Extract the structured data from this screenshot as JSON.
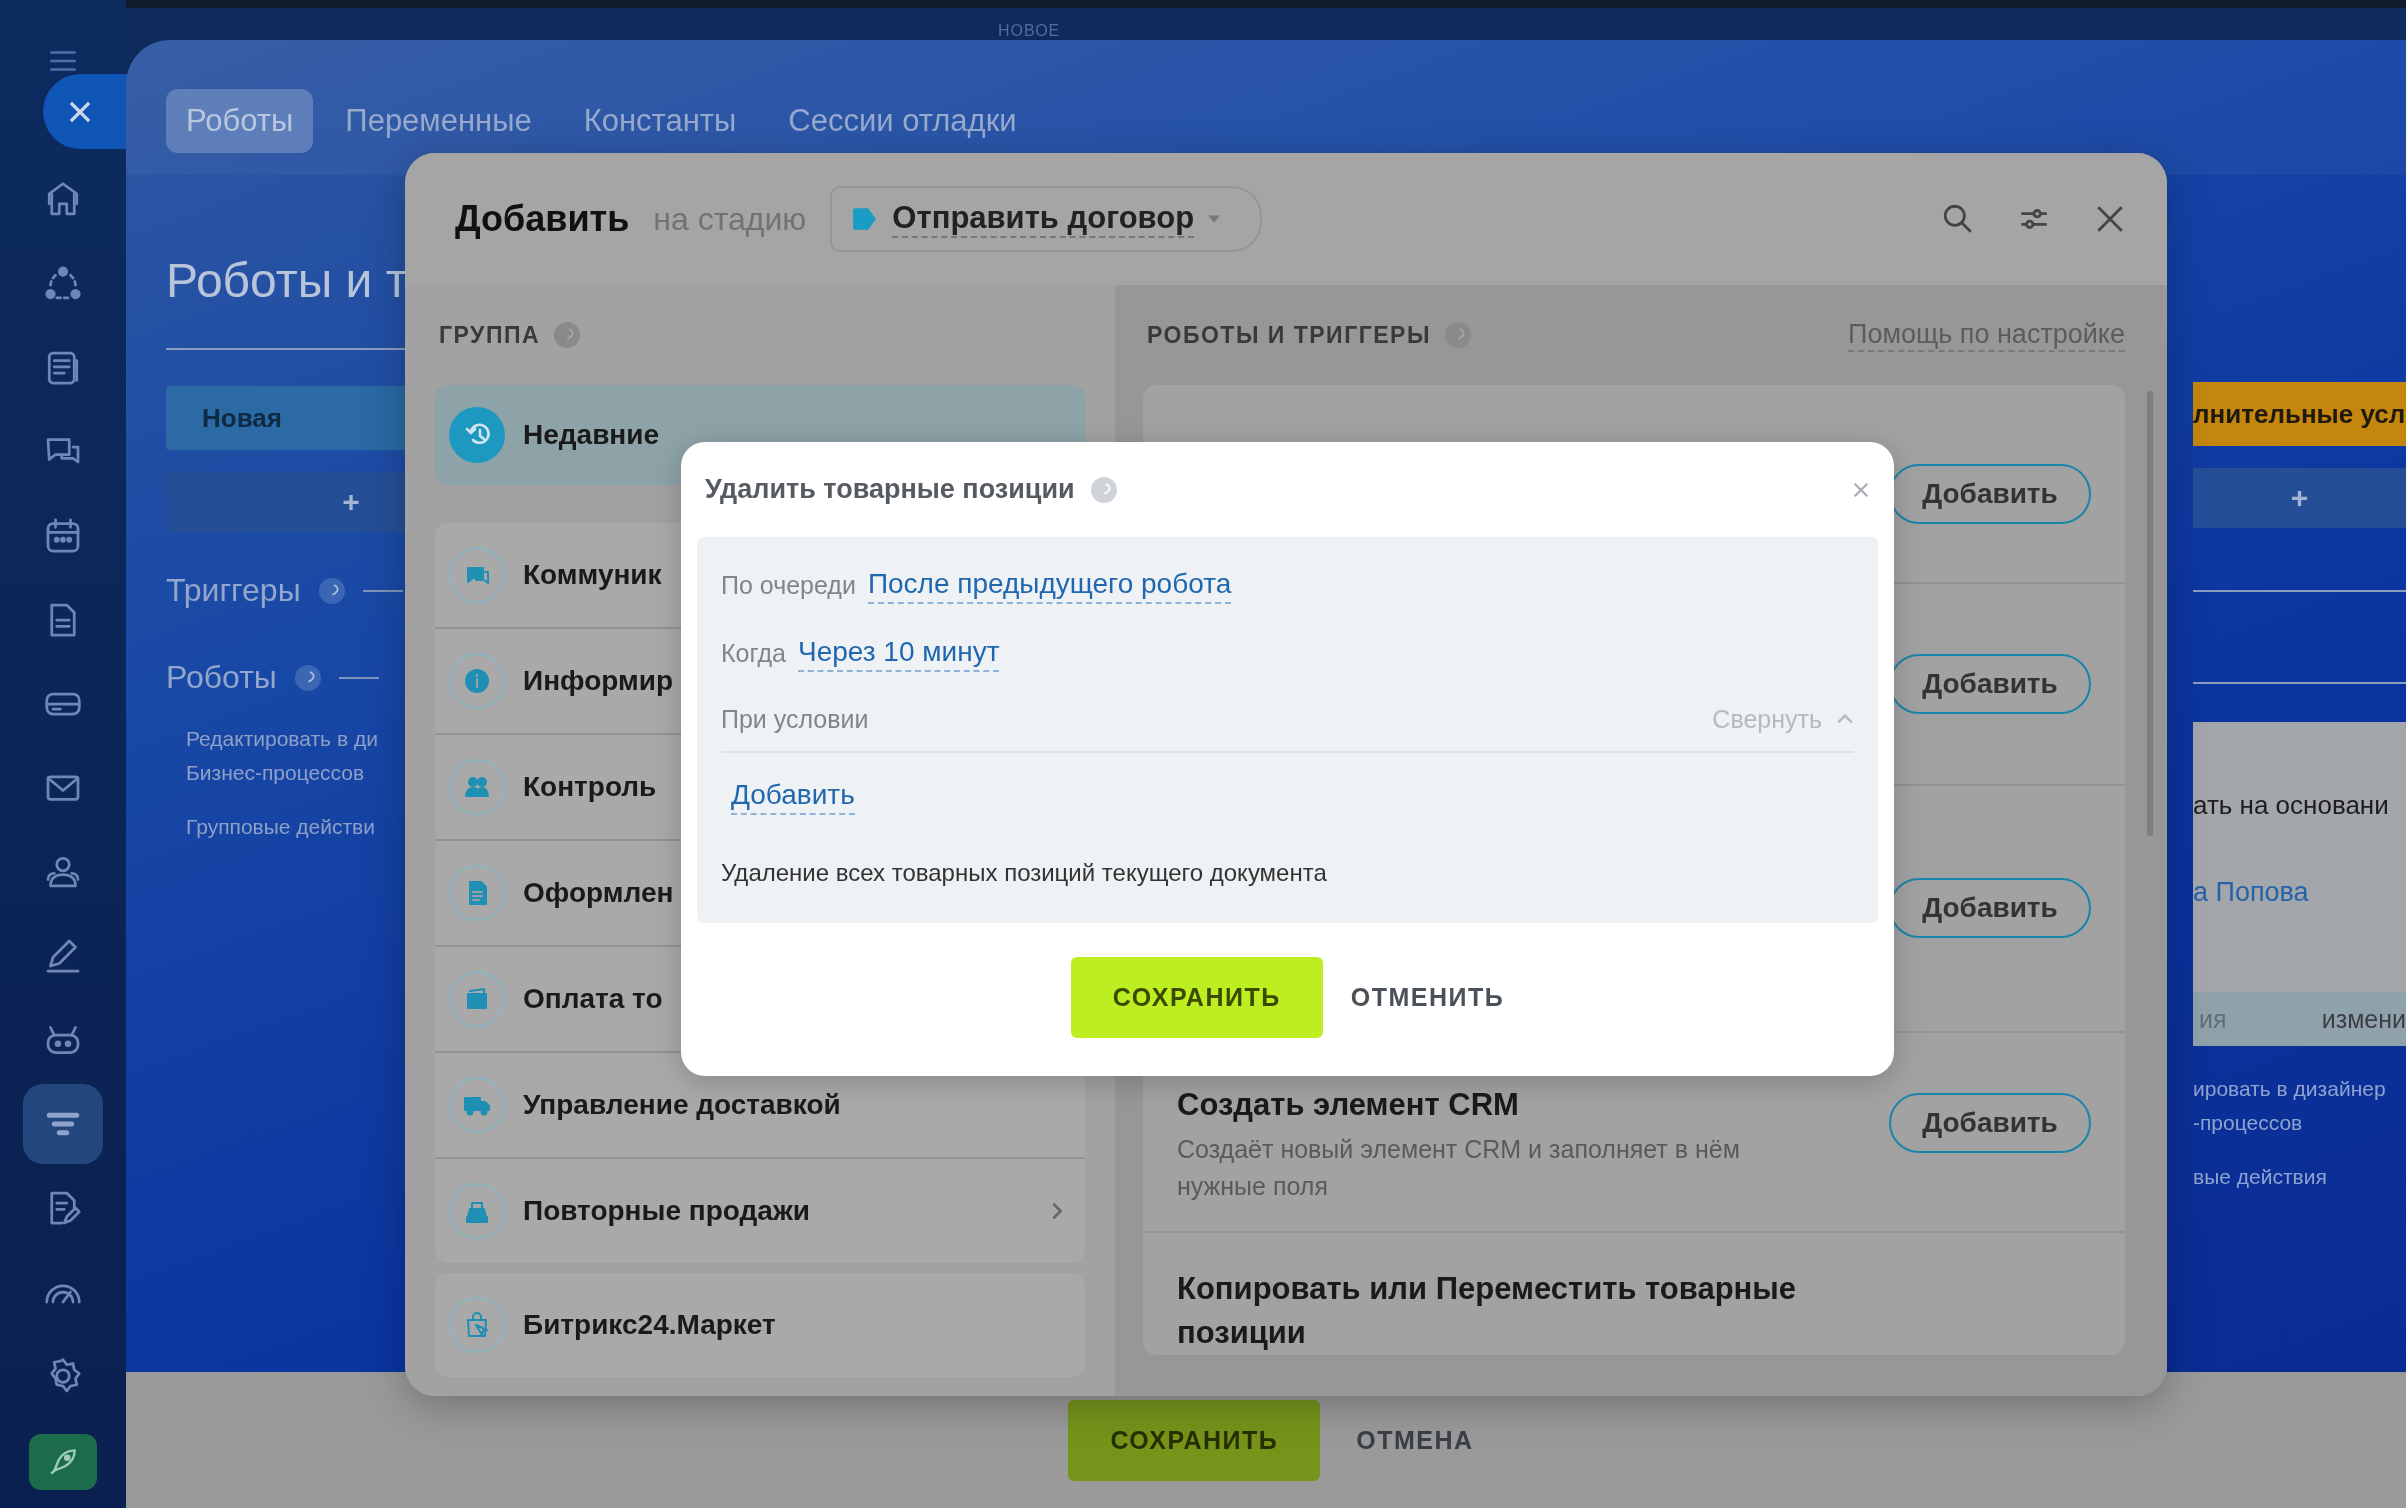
{
  "header": {
    "badge": "НОВОЕ"
  },
  "sidebar": {
    "items": [
      {
        "selected": false
      },
      {
        "selected": false
      },
      {
        "selected": false
      },
      {
        "selected": false
      },
      {
        "selected": false
      },
      {
        "selected": false
      },
      {
        "selected": false
      },
      {
        "selected": false
      },
      {
        "selected": false
      },
      {
        "selected": false
      },
      {
        "selected": false
      },
      {
        "selected": true
      },
      {
        "selected": false
      },
      {
        "selected": false
      },
      {
        "selected": false
      }
    ]
  },
  "panel": {
    "tabs": [
      {
        "label": "Роботы",
        "selected": true
      },
      {
        "label": "Переменные",
        "selected": false
      },
      {
        "label": "Константы",
        "selected": false
      },
      {
        "label": "Сессии отладки",
        "selected": false
      }
    ],
    "title": "Роботы и т",
    "stage": "Новая",
    "add_stage": "+",
    "sections": [
      {
        "label": "Триггеры"
      },
      {
        "label": "Роботы"
      }
    ],
    "links": [
      [
        "Редактировать в ди",
        "Бизнес-процессов"
      ],
      [
        "Групповые действи"
      ]
    ],
    "right": {
      "stage": "лнительные усл",
      "add_stage": "+",
      "card_text": "ать на основани",
      "card_link": "а Попова",
      "card_tabs": [
        "ия",
        "измени"
      ],
      "links": [
        [
          "ировать в дизайнер",
          "-процессов"
        ],
        [
          "вые действия"
        ]
      ]
    },
    "footer": {
      "save": "СОХРАНИТЬ",
      "cancel": "ОТМЕНА"
    }
  },
  "dialog": {
    "title": "Добавить",
    "stage_prefix": "на стадию",
    "stage": {
      "label": "Отправить договор",
      "color": "#1a9cc4"
    },
    "groups_heading": "ГРУППА",
    "recent": {
      "label": "Недавние",
      "selected": true
    },
    "groups": [
      {
        "label": "Коммуник",
        "selected": false,
        "submenu": false
      },
      {
        "label": "Информир",
        "selected": false,
        "submenu": false
      },
      {
        "label": "Контроль",
        "selected": false,
        "submenu": false
      },
      {
        "label": "Оформлен",
        "selected": false,
        "submenu": false
      },
      {
        "label": "Оплата то",
        "selected": false,
        "submenu": false
      },
      {
        "label": "Управление доставкой",
        "selected": false,
        "submenu": false
      },
      {
        "label": "Повторные продажи",
        "selected": false,
        "submenu": true
      }
    ],
    "market": "Битрикс24.Маркет",
    "robots_heading": "РОБОТЫ И ТРИГГЕРЫ",
    "help": "Помощь по настройке",
    "robots": [
      {
        "button": "Добавить"
      },
      {
        "button": "Добавить"
      },
      {
        "button": "Добавить"
      },
      {
        "title": "Создать элемент CRM",
        "description": "Создаёт новый элемент CRM и заполняет в нём нужные поля",
        "button": "Добавить"
      },
      {
        "title": "Копировать или Переместить товарные позиции"
      }
    ]
  },
  "modal": {
    "title": "Удалить товарные позиции",
    "fields": [
      {
        "label": "По очереди",
        "value": "После предыдущего робота"
      },
      {
        "label": "Когда",
        "value": "Через 10 минут"
      }
    ],
    "condition": {
      "label": "При условии",
      "toggle": "Свернуть",
      "expanded": true,
      "add": "Добавить"
    },
    "description": "Удаление всех товарных позиций текущего документа",
    "save": "СОХРАНИТЬ",
    "cancel": "ОТМЕНИТЬ"
  }
}
